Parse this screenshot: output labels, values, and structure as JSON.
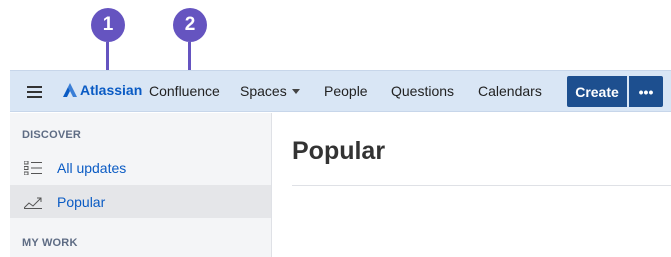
{
  "callouts": [
    "1",
    "2"
  ],
  "nav": {
    "logo_text": "Atlassian",
    "app_name": "Confluence",
    "items": [
      "Spaces",
      "People",
      "Questions",
      "Calendars"
    ],
    "create_label": "Create",
    "more_label": "•••"
  },
  "sidebar": {
    "discover_heading": "DISCOVER",
    "items": [
      {
        "label": "All updates",
        "icon": "list-icon"
      },
      {
        "label": "Popular",
        "icon": "trending-icon",
        "active": true
      }
    ],
    "my_work_heading": "MY WORK"
  },
  "main": {
    "title": "Popular"
  },
  "colors": {
    "topbar_bg": "#d9e6f5",
    "create_button": "#1d4f8f",
    "link": "#0a5bc4",
    "callout": "#6554c0"
  }
}
